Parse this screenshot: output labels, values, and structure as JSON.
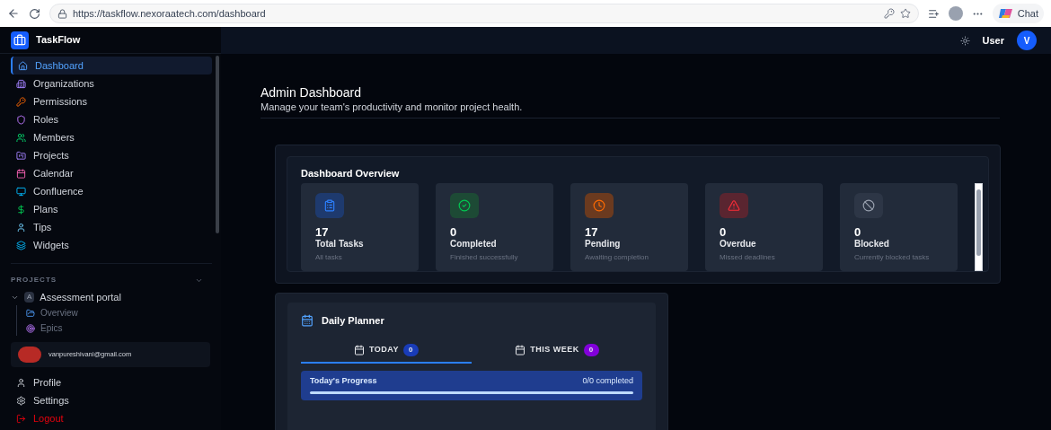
{
  "browser": {
    "url": "https://taskflow.nexoraatech.com/dashboard",
    "chat_label": "Chat"
  },
  "app": {
    "brand": "TaskFlow",
    "user_label": "User",
    "avatar_letter": "V"
  },
  "sidebar": {
    "items": [
      {
        "label": "Dashboard",
        "selected": true
      },
      {
        "label": "Organizations",
        "selected": false
      },
      {
        "label": "Permissions",
        "selected": false
      },
      {
        "label": "Roles",
        "selected": false
      },
      {
        "label": "Members",
        "selected": false
      },
      {
        "label": "Projects",
        "selected": false
      },
      {
        "label": "Calendar",
        "selected": false
      },
      {
        "label": "Confluence",
        "selected": false
      },
      {
        "label": "Plans",
        "selected": false
      },
      {
        "label": "Tips",
        "selected": false
      },
      {
        "label": "Widgets",
        "selected": false
      }
    ],
    "projects_heading": "PROJECTS",
    "projects": [
      {
        "badge": "A",
        "label": "Assessment portal",
        "expanded": true,
        "children": [
          {
            "label": "Overview"
          },
          {
            "label": "Epics"
          }
        ]
      }
    ],
    "account": {
      "email": "vanpureshivani@gmail.com"
    },
    "bottom_items": [
      {
        "label": "Profile",
        "kind": "normal"
      },
      {
        "label": "Settings",
        "kind": "normal"
      },
      {
        "label": "Logout",
        "kind": "danger"
      }
    ]
  },
  "page": {
    "title": "Admin Dashboard",
    "subtitle": "Manage your team's productivity and monitor project health."
  },
  "overview": {
    "title": "Dashboard Overview",
    "stats": [
      {
        "kind": "tasks",
        "value": "17",
        "label": "Total Tasks",
        "caption": "All tasks"
      },
      {
        "kind": "completed",
        "value": "0",
        "label": "Completed",
        "caption": "Finished successfully"
      },
      {
        "kind": "pending",
        "value": "17",
        "label": "Pending",
        "caption": "Awaiting completion"
      },
      {
        "kind": "overdue",
        "value": "0",
        "label": "Overdue",
        "caption": "Missed deadlines"
      },
      {
        "kind": "blocked",
        "value": "0",
        "label": "Blocked",
        "caption": "Currently blocked tasks"
      }
    ]
  },
  "planner": {
    "title": "Daily Planner",
    "tabs": [
      {
        "label": "TODAY",
        "count": "0",
        "selected": true
      },
      {
        "label": "THIS WEEK",
        "count": "0",
        "selected": false
      }
    ],
    "progress": {
      "label": "Today's Progress",
      "reading": "0/0 completed"
    }
  }
}
